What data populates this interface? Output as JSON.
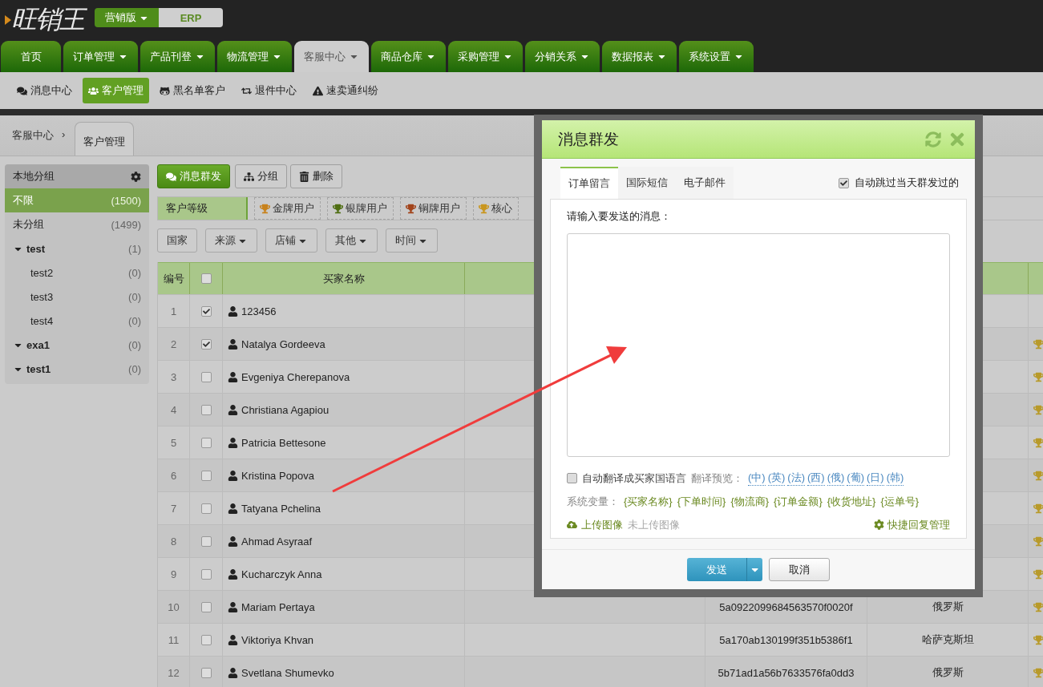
{
  "logo": "旺销王",
  "edition": {
    "label": "营销版",
    "alt": "ERP"
  },
  "nav": [
    {
      "label": "首页",
      "dropdown": false,
      "selected": false
    },
    {
      "label": "订单管理",
      "dropdown": true,
      "selected": false
    },
    {
      "label": "产品刊登",
      "dropdown": true,
      "selected": false
    },
    {
      "label": "物流管理",
      "dropdown": true,
      "selected": false
    },
    {
      "label": "客服中心",
      "dropdown": true,
      "selected": true
    },
    {
      "label": "商品仓库",
      "dropdown": true,
      "selected": false
    },
    {
      "label": "采购管理",
      "dropdown": true,
      "selected": false
    },
    {
      "label": "分销关系",
      "dropdown": true,
      "selected": false
    },
    {
      "label": "数据报表",
      "dropdown": true,
      "selected": false
    },
    {
      "label": "系统设置",
      "dropdown": true,
      "selected": false
    }
  ],
  "subnav": [
    {
      "label": "消息中心",
      "selected": false
    },
    {
      "label": "客户管理",
      "selected": true
    },
    {
      "label": "黑名单客户",
      "selected": false
    },
    {
      "label": "退件中心",
      "selected": false
    },
    {
      "label": "速卖通纠纷",
      "selected": false
    }
  ],
  "breadcrumb": {
    "parent": "客服中心",
    "separator": "›",
    "current": "客户管理"
  },
  "sidebar": {
    "title": "本地分组",
    "items": [
      {
        "kind": "plain",
        "label": "不限",
        "count": "(1500)",
        "selected": true
      },
      {
        "kind": "plain",
        "label": "未分组",
        "count": "(1499)",
        "selected": false
      },
      {
        "kind": "group",
        "label": "test",
        "count": "(1)",
        "selected": false,
        "expanded": true,
        "children": [
          {
            "kind": "plain",
            "label": "test2",
            "count": "(0)",
            "selected": false
          },
          {
            "kind": "plain",
            "label": "test3",
            "count": "(0)",
            "selected": false
          },
          {
            "kind": "plain",
            "label": "test4",
            "count": "(0)",
            "selected": false
          }
        ]
      },
      {
        "kind": "group",
        "label": "exa1",
        "count": "(0)",
        "selected": false,
        "expanded": true
      },
      {
        "kind": "group",
        "label": "test1",
        "count": "(0)",
        "selected": false,
        "expanded": true
      }
    ]
  },
  "toolbar": [
    {
      "label": "消息群发",
      "primary": true
    },
    {
      "label": "分组",
      "primary": false
    },
    {
      "label": "删除",
      "primary": false
    }
  ],
  "levels": {
    "label": "客户等级",
    "items": [
      {
        "label": "金牌用户",
        "color": "#c8821c"
      },
      {
        "label": "银牌用户",
        "color": "#4f6e12"
      },
      {
        "label": "铜牌用户",
        "color": "#a2431a"
      },
      {
        "label": "核心",
        "color": "#c9961e"
      }
    ]
  },
  "filters": [
    {
      "label": "国家",
      "dropdown": false
    },
    {
      "label": "来源",
      "dropdown": true
    },
    {
      "label": "店铺",
      "dropdown": true
    },
    {
      "label": "其他",
      "dropdown": true
    },
    {
      "label": "时间",
      "dropdown": true
    }
  ],
  "table": {
    "columns": [
      {
        "kind": "text",
        "label": "编号"
      },
      {
        "kind": "checkbox",
        "checked": false
      },
      {
        "kind": "text",
        "label": "买家名称"
      }
    ],
    "rows": [
      {
        "no": "1",
        "checked": true,
        "name": "123456",
        "trophy": false
      },
      {
        "no": "2",
        "checked": true,
        "name": "Natalya Gordeeva",
        "trophy": true
      },
      {
        "no": "3",
        "checked": false,
        "name": "Evgeniya Cherepanova",
        "trophy": true
      },
      {
        "no": "4",
        "checked": false,
        "name": "Christiana Agapiou",
        "trophy": true
      },
      {
        "no": "5",
        "checked": false,
        "name": "Patricia Bettesone",
        "trophy": true
      },
      {
        "no": "6",
        "checked": false,
        "name": "Kristina Popova",
        "trophy": true
      },
      {
        "no": "7",
        "checked": false,
        "name": "Tatyana Pchelina",
        "trophy": true
      },
      {
        "no": "8",
        "checked": false,
        "name": "Ahmad Asyraaf",
        "trophy": true
      },
      {
        "no": "9",
        "checked": false,
        "name": "Kucharczyk Anna",
        "trophy": true
      },
      {
        "no": "10",
        "checked": false,
        "name": "Mariam Pertaya",
        "column_5": "5a0922099684563570f0020f",
        "column_6": "俄罗斯",
        "trophy": true
      },
      {
        "no": "11",
        "checked": false,
        "name": "Viktoriya Khvan",
        "column_5": "5a170ab130199f351b5386f1",
        "column_6": "哈萨克斯坦",
        "trophy": true
      },
      {
        "no": "12",
        "checked": false,
        "name": "Svetlana Shumevko",
        "column_5": "5b71ad1a56b7633576fa0dd3",
        "column_6": "俄罗斯",
        "trophy": true
      }
    ]
  },
  "dialog": {
    "title": "消息群发",
    "tabs": [
      {
        "label": "订单留言",
        "selected": true
      },
      {
        "label": "国际短信",
        "selected": false
      },
      {
        "label": "电子邮件",
        "selected": false
      }
    ],
    "skip_sent": {
      "label": "自动跳过当天群发过的",
      "checked": true
    },
    "prompt": "请输入要发送的消息：",
    "translate": {
      "label": "自动翻译成买家国语言",
      "checked": false,
      "preview_label": "翻译预览：",
      "languages": [
        "(中)",
        "(英)",
        "(法)",
        "(西)",
        "(俄)",
        "(葡)",
        "(日)",
        "(韩)"
      ]
    },
    "variables": {
      "label": "系统变量：",
      "items": [
        "{买家名称}",
        "{下单时间}",
        "{物流商}",
        "{订单金额}",
        "{收货地址}",
        "{运单号}"
      ]
    },
    "upload": {
      "label": "上传图像",
      "status": "未上传图像"
    },
    "quick_reply": "快捷回复管理",
    "buttons": {
      "send": "发送",
      "cancel": "取消"
    }
  }
}
